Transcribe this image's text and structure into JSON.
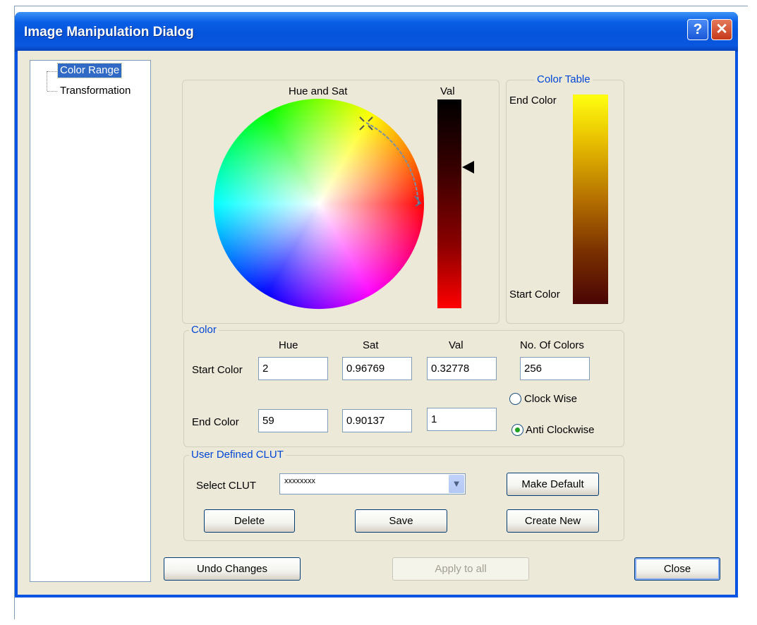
{
  "window": {
    "title": "Image Manipulation Dialog",
    "help_glyph": "?",
    "close_glyph": "✕"
  },
  "tree": {
    "items": [
      {
        "label": "Color Range",
        "selected": true
      },
      {
        "label": "Transformation",
        "selected": false
      }
    ]
  },
  "hue_sat": {
    "label": "Hue and Sat",
    "val_label": "Val"
  },
  "color_table": {
    "title": "Color Table",
    "end_label": "End Color",
    "start_label": "Start Color"
  },
  "color_group": {
    "title": "Color",
    "headers": {
      "hue": "Hue",
      "sat": "Sat",
      "val": "Val",
      "num_colors": "No. Of Colors"
    },
    "start": {
      "label": "Start Color",
      "hue": "2",
      "sat": "0.96769",
      "val": "0.32778",
      "num_colors": "256"
    },
    "end": {
      "label": "End Color",
      "hue": "59",
      "sat": "0.90137",
      "val": "1"
    },
    "direction": {
      "clockwise_label": "Clock Wise",
      "anticlockwise_label": "Anti Clockwise",
      "selected": "anticlockwise"
    }
  },
  "clut_group": {
    "title": "User Defined CLUT",
    "select_label": "Select CLUT",
    "select_value": "xxxxxxxx",
    "make_default": "Make Default",
    "delete": "Delete",
    "save": "Save",
    "create_new": "Create New"
  },
  "footer": {
    "undo": "Undo Changes",
    "apply_all": "Apply to all",
    "close": "Close"
  },
  "colors": {
    "title_bar": "#0a5fe7",
    "dialog_bg": "#ece9d8",
    "group_title": "#0046d5",
    "selection": "#316ac5"
  }
}
